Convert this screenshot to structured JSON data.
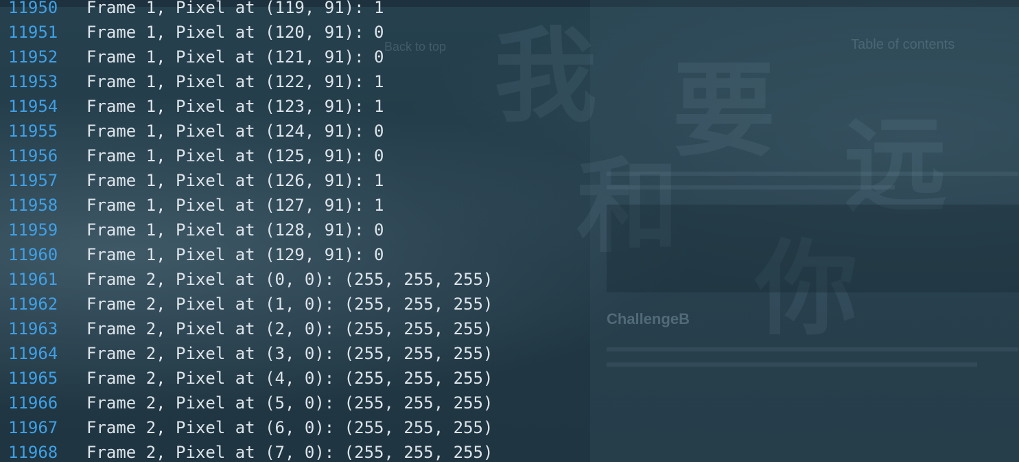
{
  "terminal": {
    "lines": [
      {
        "num": "11950",
        "text": "Frame 1, Pixel at (119, 91): 1"
      },
      {
        "num": "11951",
        "text": "Frame 1, Pixel at (120, 91): 0"
      },
      {
        "num": "11952",
        "text": "Frame 1, Pixel at (121, 91): 0"
      },
      {
        "num": "11953",
        "text": "Frame 1, Pixel at (122, 91): 1"
      },
      {
        "num": "11954",
        "text": "Frame 1, Pixel at (123, 91): 1"
      },
      {
        "num": "11955",
        "text": "Frame 1, Pixel at (124, 91): 0"
      },
      {
        "num": "11956",
        "text": "Frame 1, Pixel at (125, 91): 0"
      },
      {
        "num": "11957",
        "text": "Frame 1, Pixel at (126, 91): 1"
      },
      {
        "num": "11958",
        "text": "Frame 1, Pixel at (127, 91): 1"
      },
      {
        "num": "11959",
        "text": "Frame 1, Pixel at (128, 91): 0"
      },
      {
        "num": "11960",
        "text": "Frame 1, Pixel at (129, 91): 0"
      },
      {
        "num": "11961",
        "text": "Frame 2, Pixel at (0, 0): (255, 255, 255)"
      },
      {
        "num": "11962",
        "text": "Frame 2, Pixel at (1, 0): (255, 255, 255)"
      },
      {
        "num": "11963",
        "text": "Frame 2, Pixel at (2, 0): (255, 255, 255)"
      },
      {
        "num": "11964",
        "text": "Frame 2, Pixel at (3, 0): (255, 255, 255)"
      },
      {
        "num": "11965",
        "text": "Frame 2, Pixel at (4, 0): (255, 255, 255)"
      },
      {
        "num": "11966",
        "text": "Frame 2, Pixel at (5, 0): (255, 255, 255)"
      },
      {
        "num": "11967",
        "text": "Frame 2, Pixel at (6, 0): (255, 255, 255)"
      },
      {
        "num": "11968",
        "text": "Frame 2, Pixel at (7, 0): (255, 255, 255)"
      }
    ]
  },
  "background": {
    "heading": "ChallengeB",
    "toc": "Table of contents",
    "back_to_top": "Back to top"
  },
  "colors": {
    "line_number": "#3fa0e6",
    "output_text": "#dde4ea",
    "background": "#233a46"
  }
}
